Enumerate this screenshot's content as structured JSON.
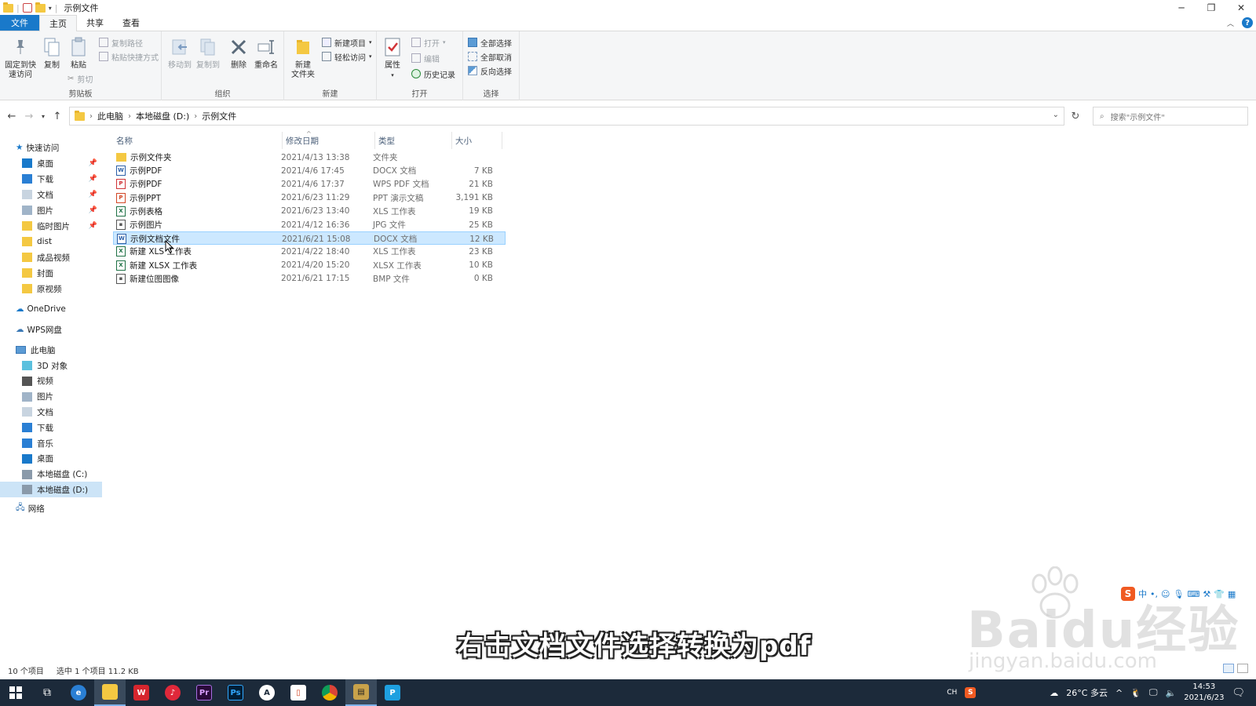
{
  "window": {
    "title": "示例文件"
  },
  "tabs": {
    "file": "文件",
    "home": "主页",
    "share": "共享",
    "view": "查看"
  },
  "ribbon": {
    "clipboard": {
      "label": "剪贴板",
      "pin": "固定到快\n速访问",
      "copy": "复制",
      "paste": "粘贴",
      "copy_path": "复制路径",
      "paste_shortcut": "粘贴快捷方式",
      "cut": "剪切"
    },
    "organize": {
      "label": "组织",
      "move_to": "移动到",
      "copy_to": "复制到",
      "delete": "删除",
      "rename": "重命名"
    },
    "new": {
      "label": "新建",
      "new_folder": "新建\n文件夹",
      "new_item": "新建项目",
      "easy_access": "轻松访问"
    },
    "open": {
      "label": "打开",
      "properties": "属性",
      "open": "打开",
      "edit": "编辑",
      "history": "历史记录"
    },
    "select": {
      "label": "选择",
      "select_all": "全部选择",
      "select_none": "全部取消",
      "invert": "反向选择"
    }
  },
  "address": {
    "crumbs": [
      "此电脑",
      "本地磁盘 (D:)",
      "示例文件"
    ],
    "search_placeholder": "搜索\"示例文件\""
  },
  "nav": {
    "quick_access": "快速访问",
    "quick_items": [
      {
        "label": "桌面",
        "icon": "desktop-icon",
        "pinned": true
      },
      {
        "label": "下载",
        "icon": "download-icon",
        "pinned": true
      },
      {
        "label": "文档",
        "icon": "document-icon",
        "pinned": true
      },
      {
        "label": "图片",
        "icon": "pictures-icon",
        "pinned": true
      },
      {
        "label": "临时图片",
        "icon": "folder-icon",
        "pinned": true
      },
      {
        "label": "dist",
        "icon": "folder-icon",
        "pinned": false
      },
      {
        "label": "成品视频",
        "icon": "folder-icon",
        "pinned": false
      },
      {
        "label": "封面",
        "icon": "folder-icon",
        "pinned": false
      },
      {
        "label": "原视频",
        "icon": "folder-icon",
        "pinned": false
      }
    ],
    "onedrive": "OneDrive",
    "wps": "WPS网盘",
    "this_pc": "此电脑",
    "pc_items": [
      {
        "label": "3D 对象",
        "icon": "3d-objects-icon"
      },
      {
        "label": "视频",
        "icon": "video-icon"
      },
      {
        "label": "图片",
        "icon": "pictures-icon"
      },
      {
        "label": "文档",
        "icon": "document-icon"
      },
      {
        "label": "下载",
        "icon": "download-icon"
      },
      {
        "label": "音乐",
        "icon": "music-icon"
      },
      {
        "label": "桌面",
        "icon": "desktop-icon"
      },
      {
        "label": "本地磁盘 (C:)",
        "icon": "drive-icon"
      },
      {
        "label": "本地磁盘 (D:)",
        "icon": "drive-icon",
        "selected": true
      }
    ],
    "network": "网络"
  },
  "columns": {
    "name": "名称",
    "date": "修改日期",
    "type": "类型",
    "size": "大小"
  },
  "files": [
    {
      "name": "示例文件夹",
      "date": "2021/4/13 13:38",
      "type": "文件夹",
      "size": "",
      "kind": "folder"
    },
    {
      "name": "示例PDF",
      "date": "2021/4/6 17:45",
      "type": "DOCX 文档",
      "size": "7 KB",
      "kind": "doc"
    },
    {
      "name": "示例PDF",
      "date": "2021/4/6 17:37",
      "type": "WPS PDF 文档",
      "size": "21 KB",
      "kind": "pdf"
    },
    {
      "name": "示例PPT",
      "date": "2021/6/23 11:29",
      "type": "PPT 演示文稿",
      "size": "3,191 KB",
      "kind": "ppt"
    },
    {
      "name": "示例表格",
      "date": "2021/6/23 13:40",
      "type": "XLS 工作表",
      "size": "19 KB",
      "kind": "xls"
    },
    {
      "name": "示例图片",
      "date": "2021/4/12 16:36",
      "type": "JPG 文件",
      "size": "25 KB",
      "kind": "img"
    },
    {
      "name": "示例文档文件",
      "date": "2021/6/21 15:08",
      "type": "DOCX 文档",
      "size": "12 KB",
      "kind": "doc",
      "selected": true
    },
    {
      "name": "新建 XLS 工作表",
      "date": "2021/4/22 18:40",
      "type": "XLS 工作表",
      "size": "23 KB",
      "kind": "xls"
    },
    {
      "name": "新建 XLSX 工作表",
      "date": "2021/4/20 15:20",
      "type": "XLSX 工作表",
      "size": "10 KB",
      "kind": "xls"
    },
    {
      "name": "新建位图图像",
      "date": "2021/6/21 17:15",
      "type": "BMP 文件",
      "size": "0 KB",
      "kind": "img"
    }
  ],
  "status": {
    "count": "10 个项目",
    "selection": "选中 1 个项目  11.2 KB"
  },
  "caption": "右击文档文件选择转换为pdf",
  "watermark": {
    "main": "Baidu经验",
    "sub": "jingyan.baidu.com"
  },
  "ime": {
    "logo": "S",
    "mode": "中"
  },
  "taskbar": {
    "weather": "26°C 多云",
    "time": "14:53",
    "date": "2021/6/23",
    "lang": "CH"
  },
  "colors": {
    "accent": "#1979ca",
    "selection": "#cce8ff",
    "taskbar": "#1c2a3a"
  }
}
